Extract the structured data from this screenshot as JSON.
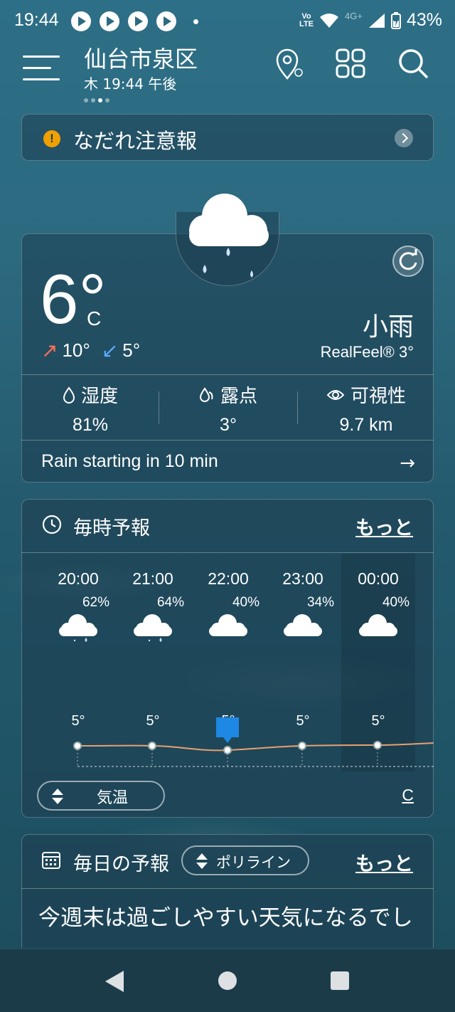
{
  "status_bar": {
    "time": "19:44",
    "volte": "Vo\nLTE",
    "network": "4G+",
    "battery": "43%"
  },
  "header": {
    "city": "仙台市泉区",
    "datetime": "木 19:44 午後"
  },
  "alert": {
    "icon": "!",
    "text": "なだれ注意報"
  },
  "current": {
    "temperature": "6°",
    "unit": "C",
    "high": "10°",
    "low": "5°",
    "condition": "小雨",
    "realfeel": "RealFeel® 3°",
    "stats": [
      {
        "label": "湿度",
        "value": "81%",
        "icon": "humidity-icon"
      },
      {
        "label": "露点",
        "value": "3°",
        "icon": "dewpoint-icon"
      },
      {
        "label": "可視性",
        "value": "9.7 km",
        "icon": "eye-icon"
      }
    ],
    "minutecast": "Rain starting in 10 min",
    "minutecast_arrow": "→"
  },
  "hourly": {
    "title": "毎時予報",
    "more": "もっと",
    "hours": [
      {
        "time": "20:00",
        "pop": "62%",
        "icon": "rain-cloud-icon",
        "temp": "5°"
      },
      {
        "time": "21:00",
        "pop": "64%",
        "icon": "rain-cloud-icon",
        "temp": "5°"
      },
      {
        "time": "22:00",
        "pop": "40%",
        "icon": "cloud-icon",
        "temp": "5°"
      },
      {
        "time": "23:00",
        "pop": "34%",
        "icon": "cloud-icon",
        "temp": "5°"
      },
      {
        "time": "00:00",
        "pop": "40%",
        "icon": "cloud-icon",
        "temp": "5°"
      }
    ],
    "toggle_label": "気温",
    "unit": "C"
  },
  "daily": {
    "title": "毎日の予報",
    "polyline_label": "ポリライン",
    "more": "もっと",
    "headline": "今週末は過ごしやすい天気になるでし"
  },
  "colors": {
    "background": "#2c6a80",
    "alert_icon": "#f0a000",
    "high_arrow": "#ff6d5a",
    "low_arrow": "#58a8ff",
    "temp_line": "#e8a070",
    "selected_marker": "#1e88e5"
  }
}
